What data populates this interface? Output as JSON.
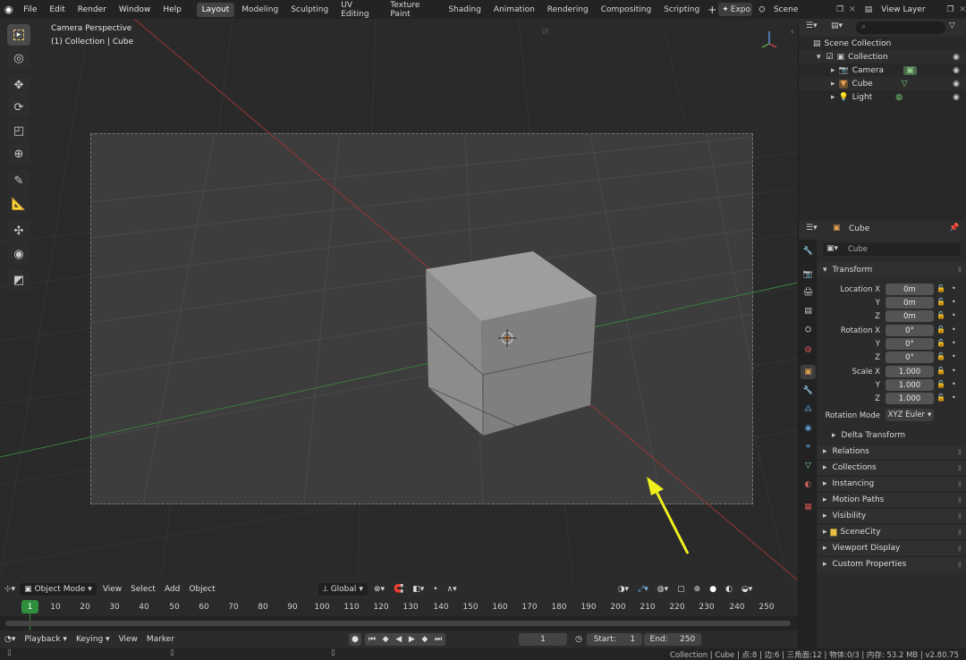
{
  "topbar": {
    "menus": [
      "File",
      "Edit",
      "Render",
      "Window",
      "Help"
    ],
    "workspaces": [
      "Layout",
      "Modeling",
      "Sculpting",
      "UV Editing",
      "Texture Paint",
      "Shading",
      "Animation",
      "Rendering",
      "Compositing",
      "Scripting"
    ],
    "active_workspace": "Layout",
    "expo_label": "Expo",
    "scene_label": "Scene",
    "view_layer_label": "View Layer"
  },
  "viewport": {
    "perspective_label": "Camera Perspective",
    "collection_label": "(1) Collection | Cube",
    "header": {
      "mode": "Object Mode",
      "menus": [
        "View",
        "Select",
        "Add",
        "Object"
      ],
      "transform_orientation": "Global"
    }
  },
  "timeline": {
    "current_frame": "1",
    "ticks": [
      "10",
      "20",
      "30",
      "40",
      "50",
      "60",
      "70",
      "80",
      "90",
      "100",
      "110",
      "120",
      "130",
      "140",
      "150",
      "160",
      "170",
      "180",
      "190",
      "200",
      "210",
      "220",
      "230",
      "240",
      "250"
    ],
    "header": {
      "playback": "Playback",
      "keying": "Keying",
      "view": "View",
      "marker": "Marker",
      "frame_field": "1",
      "start_label": "Start:",
      "start_value": "1",
      "end_label": "End:",
      "end_value": "250"
    }
  },
  "outliner": {
    "scene_collection": "Scene Collection",
    "collection": "Collection",
    "items": [
      "Camera",
      "Cube",
      "Light"
    ]
  },
  "properties": {
    "object_name": "Cube",
    "object_name_field": "Cube",
    "transform_title": "Transform",
    "location_label": "Location X",
    "rotation_label": "Rotation X",
    "scale_label": "Scale X",
    "y_label": "Y",
    "z_label": "Z",
    "location": [
      "0m",
      "0m",
      "0m"
    ],
    "rotation": [
      "0°",
      "0°",
      "0°"
    ],
    "scale": [
      "1.000",
      "1.000",
      "1.000"
    ],
    "rotation_mode_label": "Rotation Mode",
    "rotation_mode": "XYZ Euler",
    "delta_transform": "Delta Transform",
    "sections": [
      "Relations",
      "Collections",
      "Instancing",
      "Motion Paths",
      "Visibility",
      "SceneCity",
      "Viewport Display",
      "Custom Properties"
    ]
  },
  "statusbar": {
    "text": "Collection | Cube | 点:8 | 边:6 | 三角面:12 | 物体:0/3 | 内存: 53.2 MB | v2.80.75"
  },
  "colors": {
    "accent_green": "#2f8f3d",
    "annotation_arrow": "#f0f01e",
    "x_axis": "#b03a3a",
    "y_axis": "#3d8a3d"
  }
}
